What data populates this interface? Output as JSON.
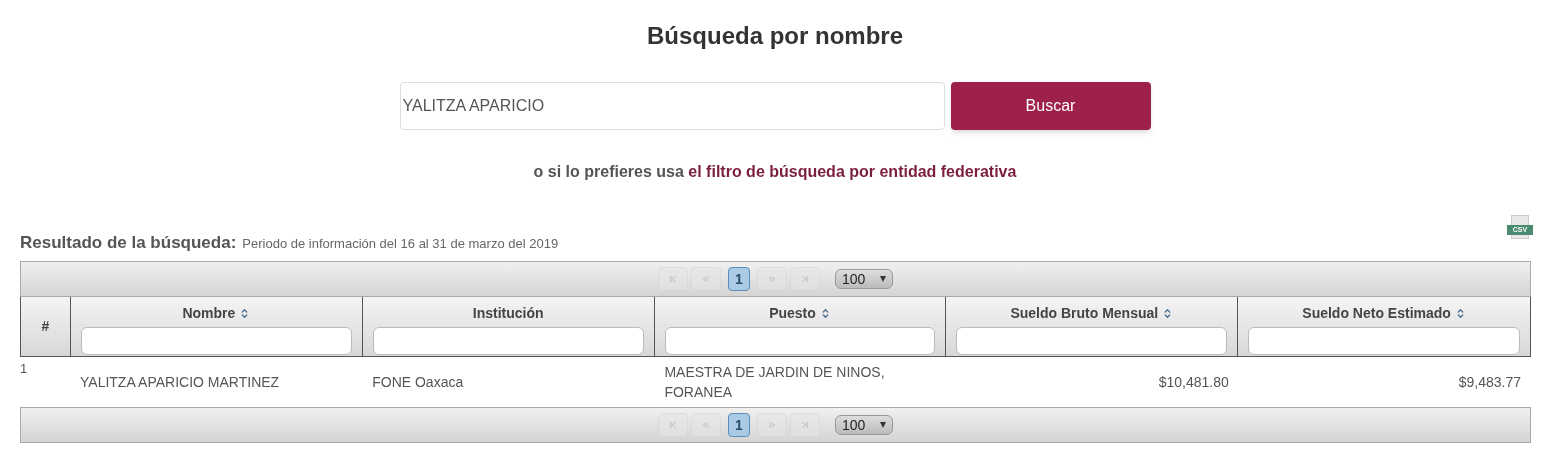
{
  "title": "Búsqueda por nombre",
  "search": {
    "value": "YALITZA APARICIO",
    "button": "Buscar"
  },
  "alt_prompt": {
    "text": "o si lo prefieres usa",
    "link": "el filtro de búsqueda por entidad federativa"
  },
  "results": {
    "heading": "Resultado de la búsqueda:",
    "period": "Periodo de información del 16 al 31 de marzo del 2019",
    "csv_label": "CSV"
  },
  "pagers": [
    {
      "pages": [
        {
          "label": "1",
          "selected": true
        }
      ],
      "page_size": "100"
    },
    {
      "pages": [
        {
          "label": "1",
          "selected": true
        }
      ],
      "page_size": "100"
    }
  ],
  "table": {
    "index_header": "#",
    "columns": [
      {
        "label": "Nombre",
        "sortable": true,
        "kind": "text"
      },
      {
        "label": "Institución",
        "sortable": false,
        "kind": "text"
      },
      {
        "label": "Puesto",
        "sortable": true,
        "kind": "text"
      },
      {
        "label": "Sueldo Bruto Mensual",
        "sortable": true,
        "kind": "amount"
      },
      {
        "label": "Sueldo Neto Estimado",
        "sortable": true,
        "kind": "amount"
      }
    ],
    "rows": [
      {
        "index": "1",
        "cells": [
          "YALITZA APARICIO MARTINEZ",
          "FONE Oaxaca",
          "MAESTRA DE JARDIN DE NINOS, FORANEA",
          "$10,481.80",
          "$9,483.77"
        ]
      }
    ]
  }
}
